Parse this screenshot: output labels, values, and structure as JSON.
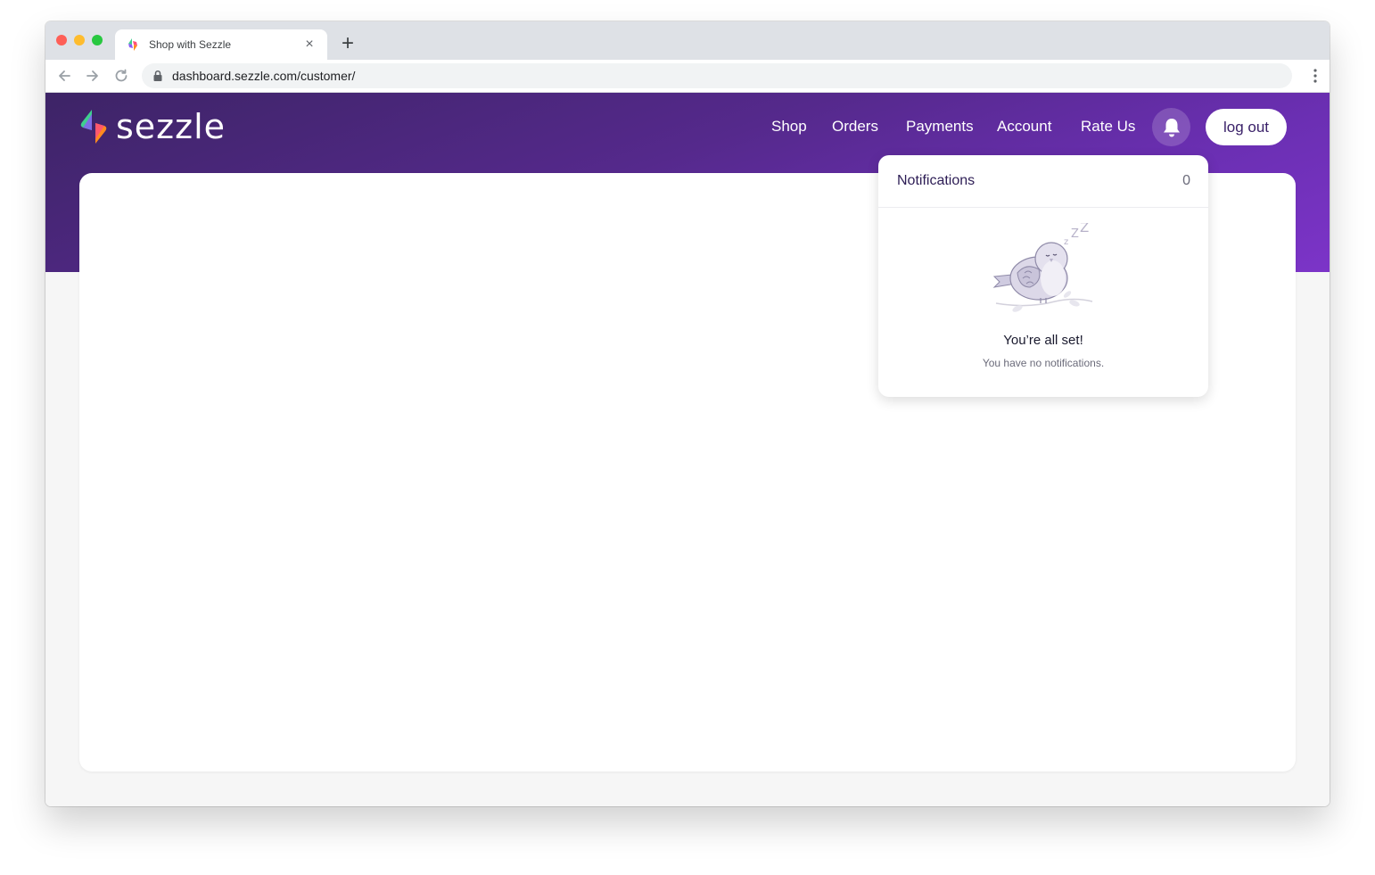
{
  "browser": {
    "tab_title": "Shop with Sezzle",
    "tab_close": "×",
    "new_tab": "+",
    "url": "dashboard.sezzle.com/customer/"
  },
  "header": {
    "logo_text": "sezzle",
    "nav": [
      "Shop",
      "Orders",
      "Payments",
      "Account",
      "Rate Us"
    ],
    "logout_label": "log out"
  },
  "notifications": {
    "title": "Notifications",
    "count": "0",
    "empty_title": "You’re all set!",
    "empty_subtitle": "You have no notifications."
  },
  "colors": {
    "brand_purple": "#55298c",
    "accent_orange": "#ff8a1f",
    "accent_green": "#3fcf8e"
  },
  "icons": [
    "back-arrow-icon",
    "forward-arrow-icon",
    "reload-icon",
    "lock-icon",
    "menu-dots-icon",
    "bell-icon",
    "sleeping-bird-illustration"
  ]
}
